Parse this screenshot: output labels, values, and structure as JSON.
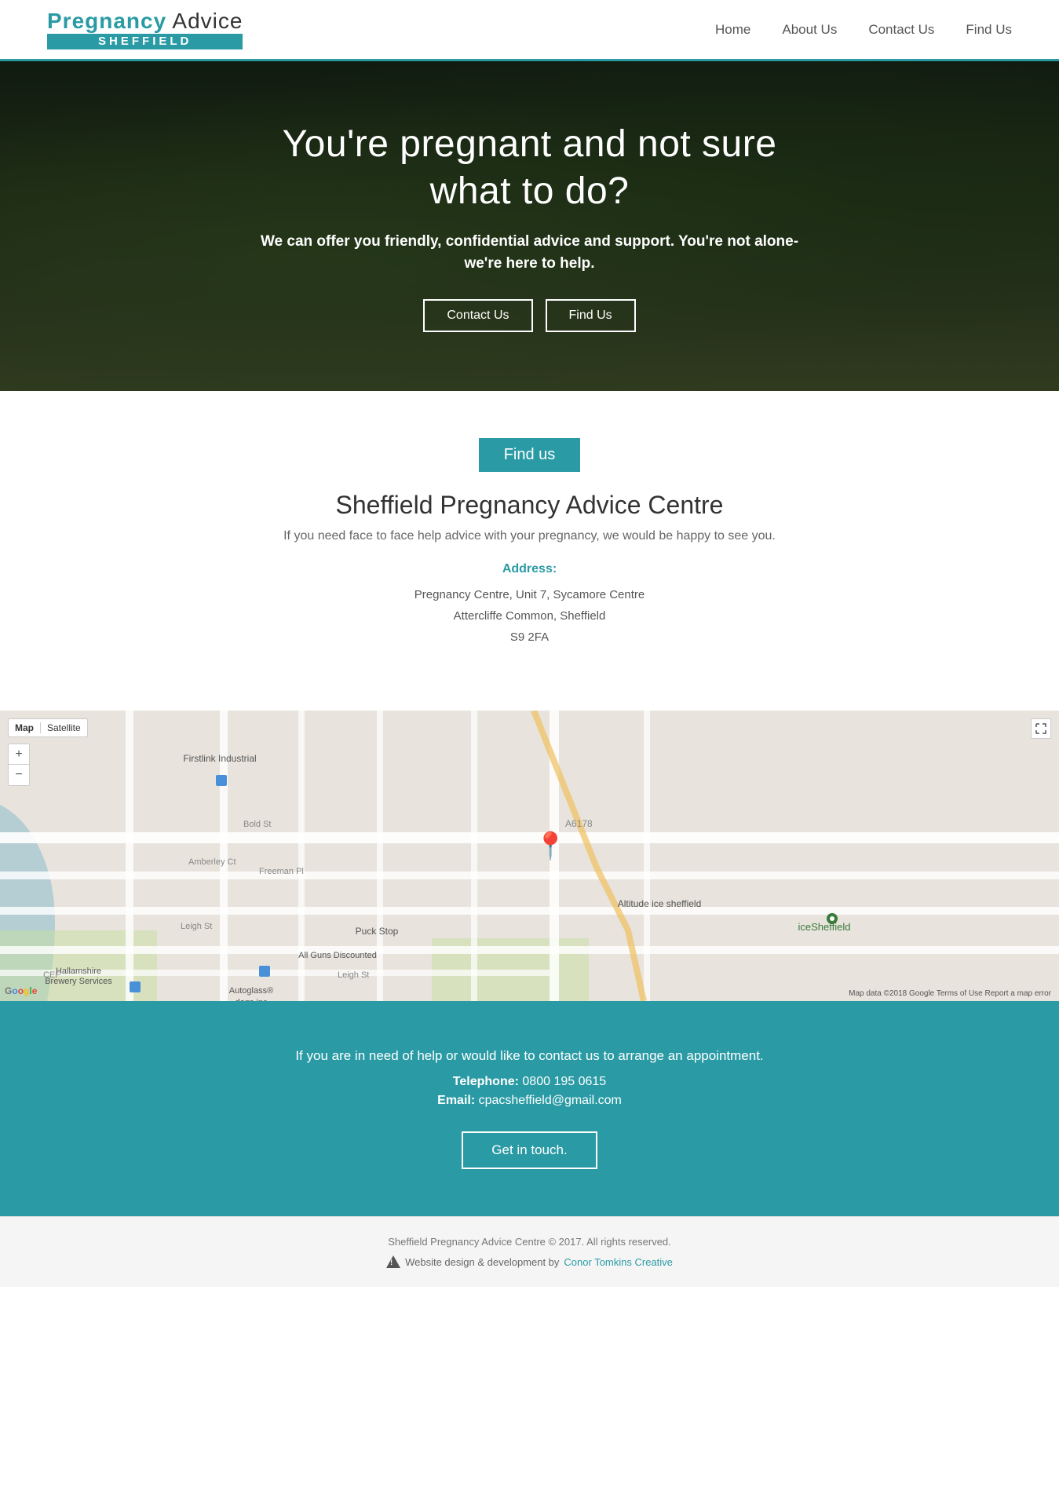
{
  "header": {
    "logo_top_part1": "Pregnancy",
    "logo_top_part2": " Advice",
    "logo_bottom": "SHEFFIELD",
    "nav": [
      {
        "label": "Home",
        "href": "#"
      },
      {
        "label": "About Us",
        "href": "#"
      },
      {
        "label": "Contact Us",
        "href": "#"
      },
      {
        "label": "Find Us",
        "href": "#"
      }
    ]
  },
  "hero": {
    "title": "You're pregnant and not sure what to do?",
    "subtitle": "We can offer you friendly, confidential advice and support. You're not alone- we're here to help.",
    "btn_contact": "Contact Us",
    "btn_find": "Find Us"
  },
  "find_us": {
    "badge": "Find us",
    "title": "Sheffield Pregnancy Advice Centre",
    "description": "If you need face to face help advice with your pregnancy, we would be happy to see you.",
    "address_label": "Address:",
    "address_line1": "Pregnancy Centre, Unit 7, Sycamore Centre",
    "address_line2": "Attercliffe Common, Sheffield",
    "address_line3": "S9 2FA"
  },
  "map": {
    "tab_map": "Map",
    "tab_satellite": "Satellite",
    "zoom_in": "+",
    "zoom_out": "−",
    "attribution": "Map data ©2018 Google  Terms of Use  Report a map error"
  },
  "contact": {
    "text": "If you are in need of help or would like to contact us to arrange an appointment.",
    "telephone_label": "Telephone:",
    "telephone_value": "0800 195 0615",
    "email_label": "Email:",
    "email_value": "cpacsheffield@gmail.com",
    "btn_label": "Get in touch."
  },
  "footer": {
    "copyright": "Sheffield Pregnancy Advice Centre © 2017. All rights reserved.",
    "dev_text": "Website design & development by",
    "dev_link_label": "Conor Tomkins Creative",
    "dev_link_href": "#"
  },
  "colors": {
    "teal": "#2a9ba5",
    "dark": "#333",
    "light_bg": "#f5f5f5"
  }
}
